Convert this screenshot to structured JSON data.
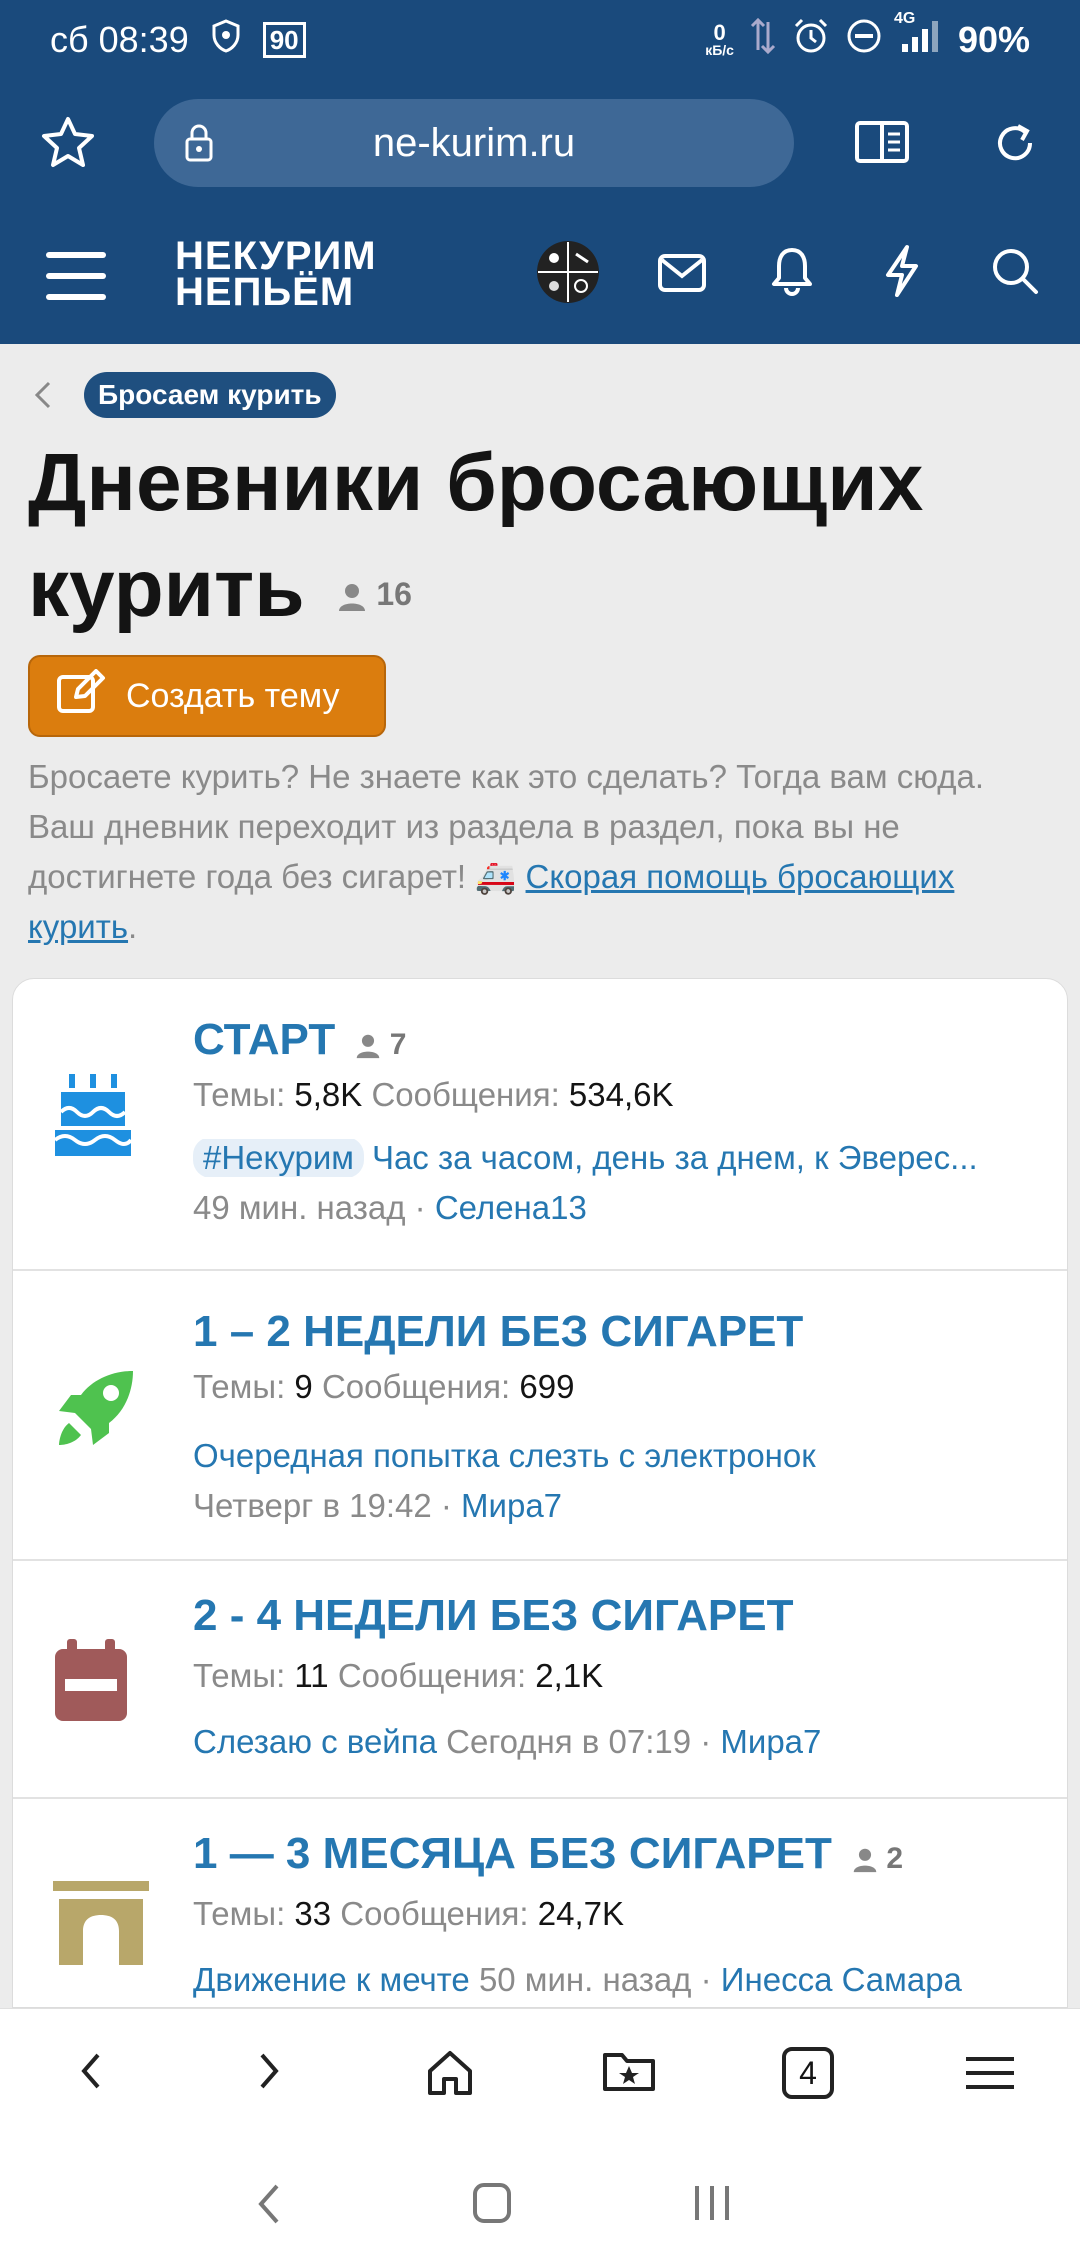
{
  "status_bar": {
    "time": "сб 08:39",
    "badge": "90",
    "net_speed_value": "0",
    "net_speed_unit": "кБ/с",
    "network": "4G",
    "battery": "90%"
  },
  "browser": {
    "url": "ne-kurim.ru",
    "tab_count": "4"
  },
  "site": {
    "logo_line1": "НЕКУРИМ",
    "logo_line2": "НЕПЬЁМ"
  },
  "breadcrumb": "Бросаем курить",
  "page": {
    "title": "Дневники бросающих курить",
    "title_part1": "Дневники бросающих",
    "title_part2": "курить",
    "watchers": "16",
    "create_button": "Создать тему",
    "description": "Бросаете курить? Не знаете как это сделать? Тогда вам сюда. Ваш дневник переходит из раздела в раздел, пока вы не достигнете года без сигарет! 🚑",
    "description_link": "Скорая помощь бросающих курить",
    "description_end": "."
  },
  "nodes": [
    {
      "title": "СТАРТ",
      "watchers": "7",
      "threads_label": "Темы:",
      "threads": "5,8K",
      "posts_label": "Сообщения:",
      "posts": "534,6K",
      "last_tag": "#Некурим",
      "last_thread": "Час за часом, день за днем, к Эверес...",
      "last_time": "49 мин. назад",
      "last_user": "Селена13",
      "icon": "birthday-cake-icon",
      "icon_color": "#1e90e0"
    },
    {
      "title": "1 – 2 НЕДЕЛИ БЕЗ СИГАРЕТ",
      "threads_label": "Темы:",
      "threads": "9",
      "posts_label": "Сообщения:",
      "posts": "699",
      "last_thread": "Очередная попытка слезть с электронок",
      "last_time": "Четверг в 19:42",
      "last_user": "Мира7",
      "icon": "rocket-icon",
      "icon_color": "#4fc24f"
    },
    {
      "title": "2 - 4 НЕДЕЛИ БЕЗ СИГАРЕТ",
      "threads_label": "Темы:",
      "threads": "11",
      "posts_label": "Сообщения:",
      "posts": "2,1K",
      "last_thread": "Слезаю с вейпа",
      "last_time": "Сегодня в 07:19",
      "last_user": "Мира7",
      "icon": "calendar-icon",
      "icon_color": "#a05a5a"
    },
    {
      "title": "1 — 3 МЕСЯЦА БЕЗ СИГАРЕТ",
      "watchers": "2",
      "threads_label": "Темы:",
      "threads": "33",
      "posts_label": "Сообщения:",
      "posts": "24,7K",
      "last_thread": "Движение к мечте",
      "last_time": "50 мин. назад",
      "last_user": "Инесса Самара",
      "icon": "arch-icon",
      "icon_color": "#b8a76a"
    }
  ]
}
